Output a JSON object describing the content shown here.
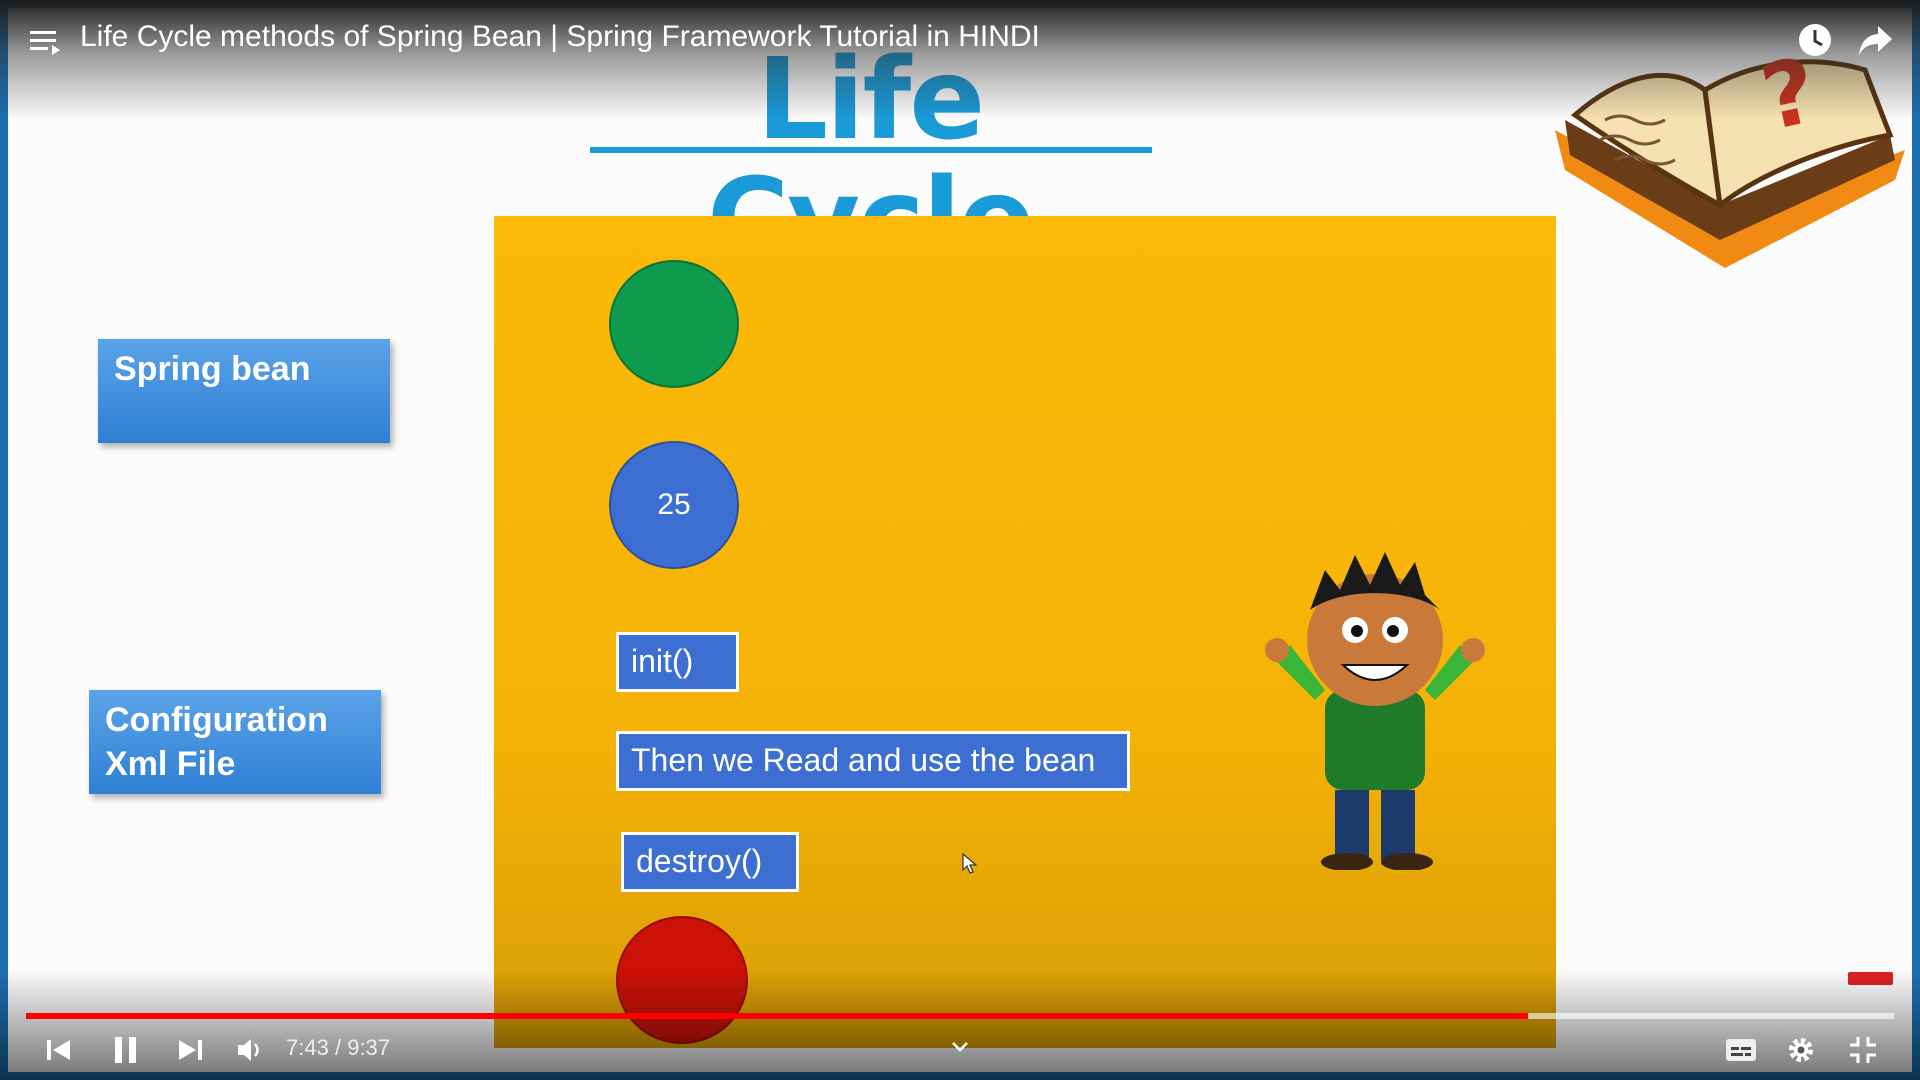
{
  "player": {
    "title": "Life Cycle methods of Spring Bean | Spring Framework Tutorial in HINDI",
    "time_current": "7:43",
    "time_separator": "/",
    "time_total": "9:37",
    "progress_fraction": 0.804,
    "colors": {
      "progress": "#ff0000",
      "frame_border": "#1b6fb0"
    },
    "icons": [
      "playlist-icon",
      "watch-later-icon",
      "share-icon",
      "previous-icon",
      "pause-icon",
      "next-icon",
      "volume-icon",
      "chevron-down-icon",
      "captions-icon",
      "settings-icon",
      "exit-fullscreen-icon",
      "subscribe-watermark-icon"
    ]
  },
  "slide": {
    "heading": "Life Cycle",
    "side_boxes": {
      "spring_bean": "Spring bean",
      "config_line1": "Configuration",
      "config_line2": "Xml File"
    },
    "blue_circle_label": "25",
    "steps": {
      "init": "init()",
      "use": "Then we Read and use the bean",
      "destroy": "destroy()"
    },
    "colors": {
      "stage": "#fdb909",
      "heading": "#1a9ad6",
      "green": "#0f9b4e",
      "blue": "#3d6ed1",
      "red": "#cc1108"
    },
    "illustrations": [
      "book-question-illustration",
      "cartoon-boy-illustration",
      "mouse-cursor-icon"
    ]
  }
}
